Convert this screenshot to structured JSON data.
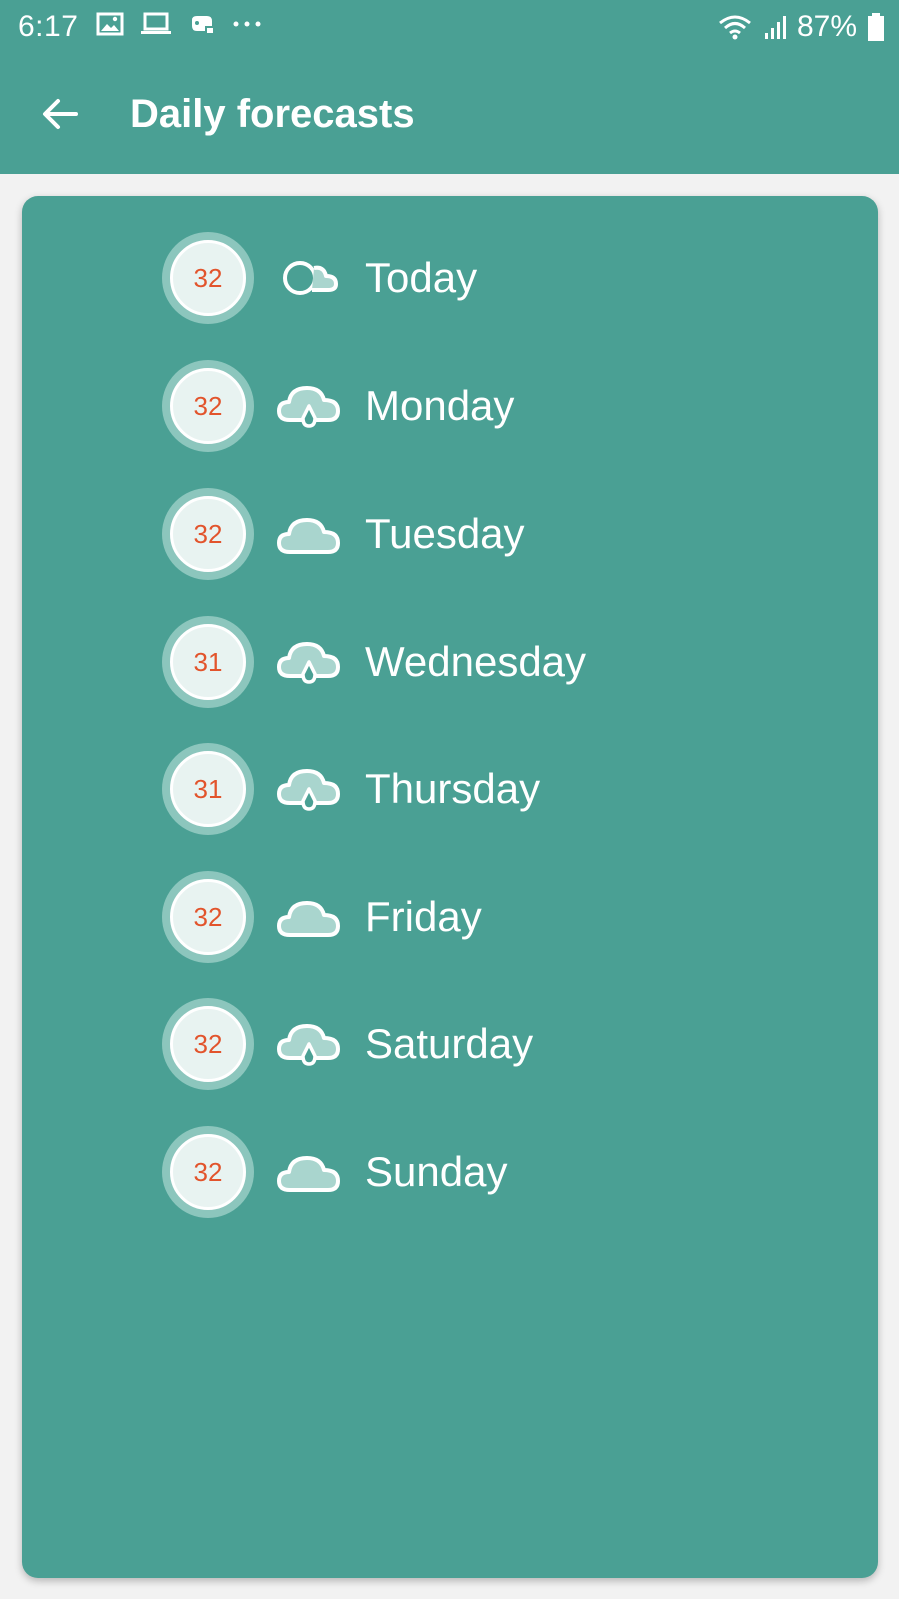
{
  "status": {
    "time": "6:17",
    "battery": "87%"
  },
  "header": {
    "title": "Daily forecasts"
  },
  "colors": {
    "primary": "#4aa094",
    "temp_text": "#e2542c"
  },
  "days": [
    {
      "temp": "32",
      "label": "Today",
      "icon": "partly-cloudy-icon"
    },
    {
      "temp": "32",
      "label": "Monday",
      "icon": "rain-cloud-icon"
    },
    {
      "temp": "32",
      "label": "Tuesday",
      "icon": "cloud-icon"
    },
    {
      "temp": "31",
      "label": "Wednesday",
      "icon": "rain-cloud-icon"
    },
    {
      "temp": "31",
      "label": "Thursday",
      "icon": "rain-cloud-icon"
    },
    {
      "temp": "32",
      "label": "Friday",
      "icon": "cloud-icon"
    },
    {
      "temp": "32",
      "label": "Saturday",
      "icon": "rain-cloud-icon"
    },
    {
      "temp": "32",
      "label": "Sunday",
      "icon": "cloud-icon"
    }
  ]
}
